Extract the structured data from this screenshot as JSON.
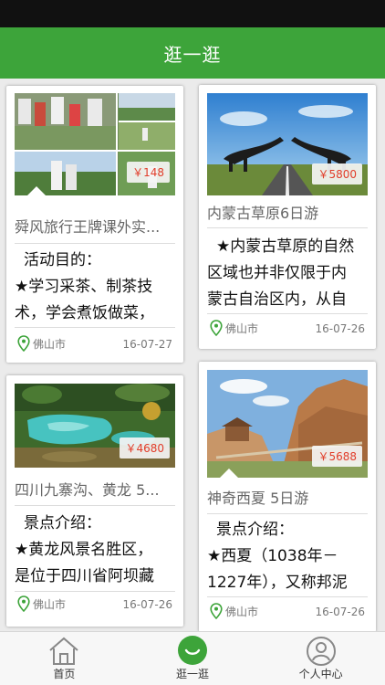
{
  "header": {
    "title": "逛一逛"
  },
  "cards": [
    {
      "title": "舜风旅行王牌课外实...",
      "price": "￥148",
      "desc": [
        "活动目的：",
        "★学习采茶、制茶技",
        "术，学会煮饭做菜，"
      ],
      "location": "佛山市",
      "date": "16-07-27"
    },
    {
      "title": "内蒙古草原6日游",
      "price": "￥5800",
      "desc": [
        "★内蒙古草原的自然",
        "区域也并非仅限于内",
        "蒙古自治区内，从自"
      ],
      "location": "佛山市",
      "date": "16-07-26"
    },
    {
      "title": "四川九寨沟、黄龙 5...",
      "price": "￥4680",
      "desc": [
        "景点介绍：",
        "★黄龙风景名胜区，",
        "是位于四川省阿坝藏"
      ],
      "location": "佛山市",
      "date": "16-07-26"
    },
    {
      "title": "神奇西夏 5日游",
      "price": "￥5688",
      "desc": [
        "景点介绍：",
        "★西夏（1038年－",
        "1227年），又称邦泥"
      ],
      "location": "佛山市",
      "date": "16-07-26"
    }
  ],
  "tabbar": {
    "items": [
      {
        "label": "首页",
        "icon": "home-icon"
      },
      {
        "label": "逛一逛",
        "icon": "browse-icon"
      },
      {
        "label": "个人中心",
        "icon": "user-icon"
      }
    ],
    "active_index": 1
  },
  "colors": {
    "brand": "#3da43a",
    "price": "#e13d2a"
  }
}
